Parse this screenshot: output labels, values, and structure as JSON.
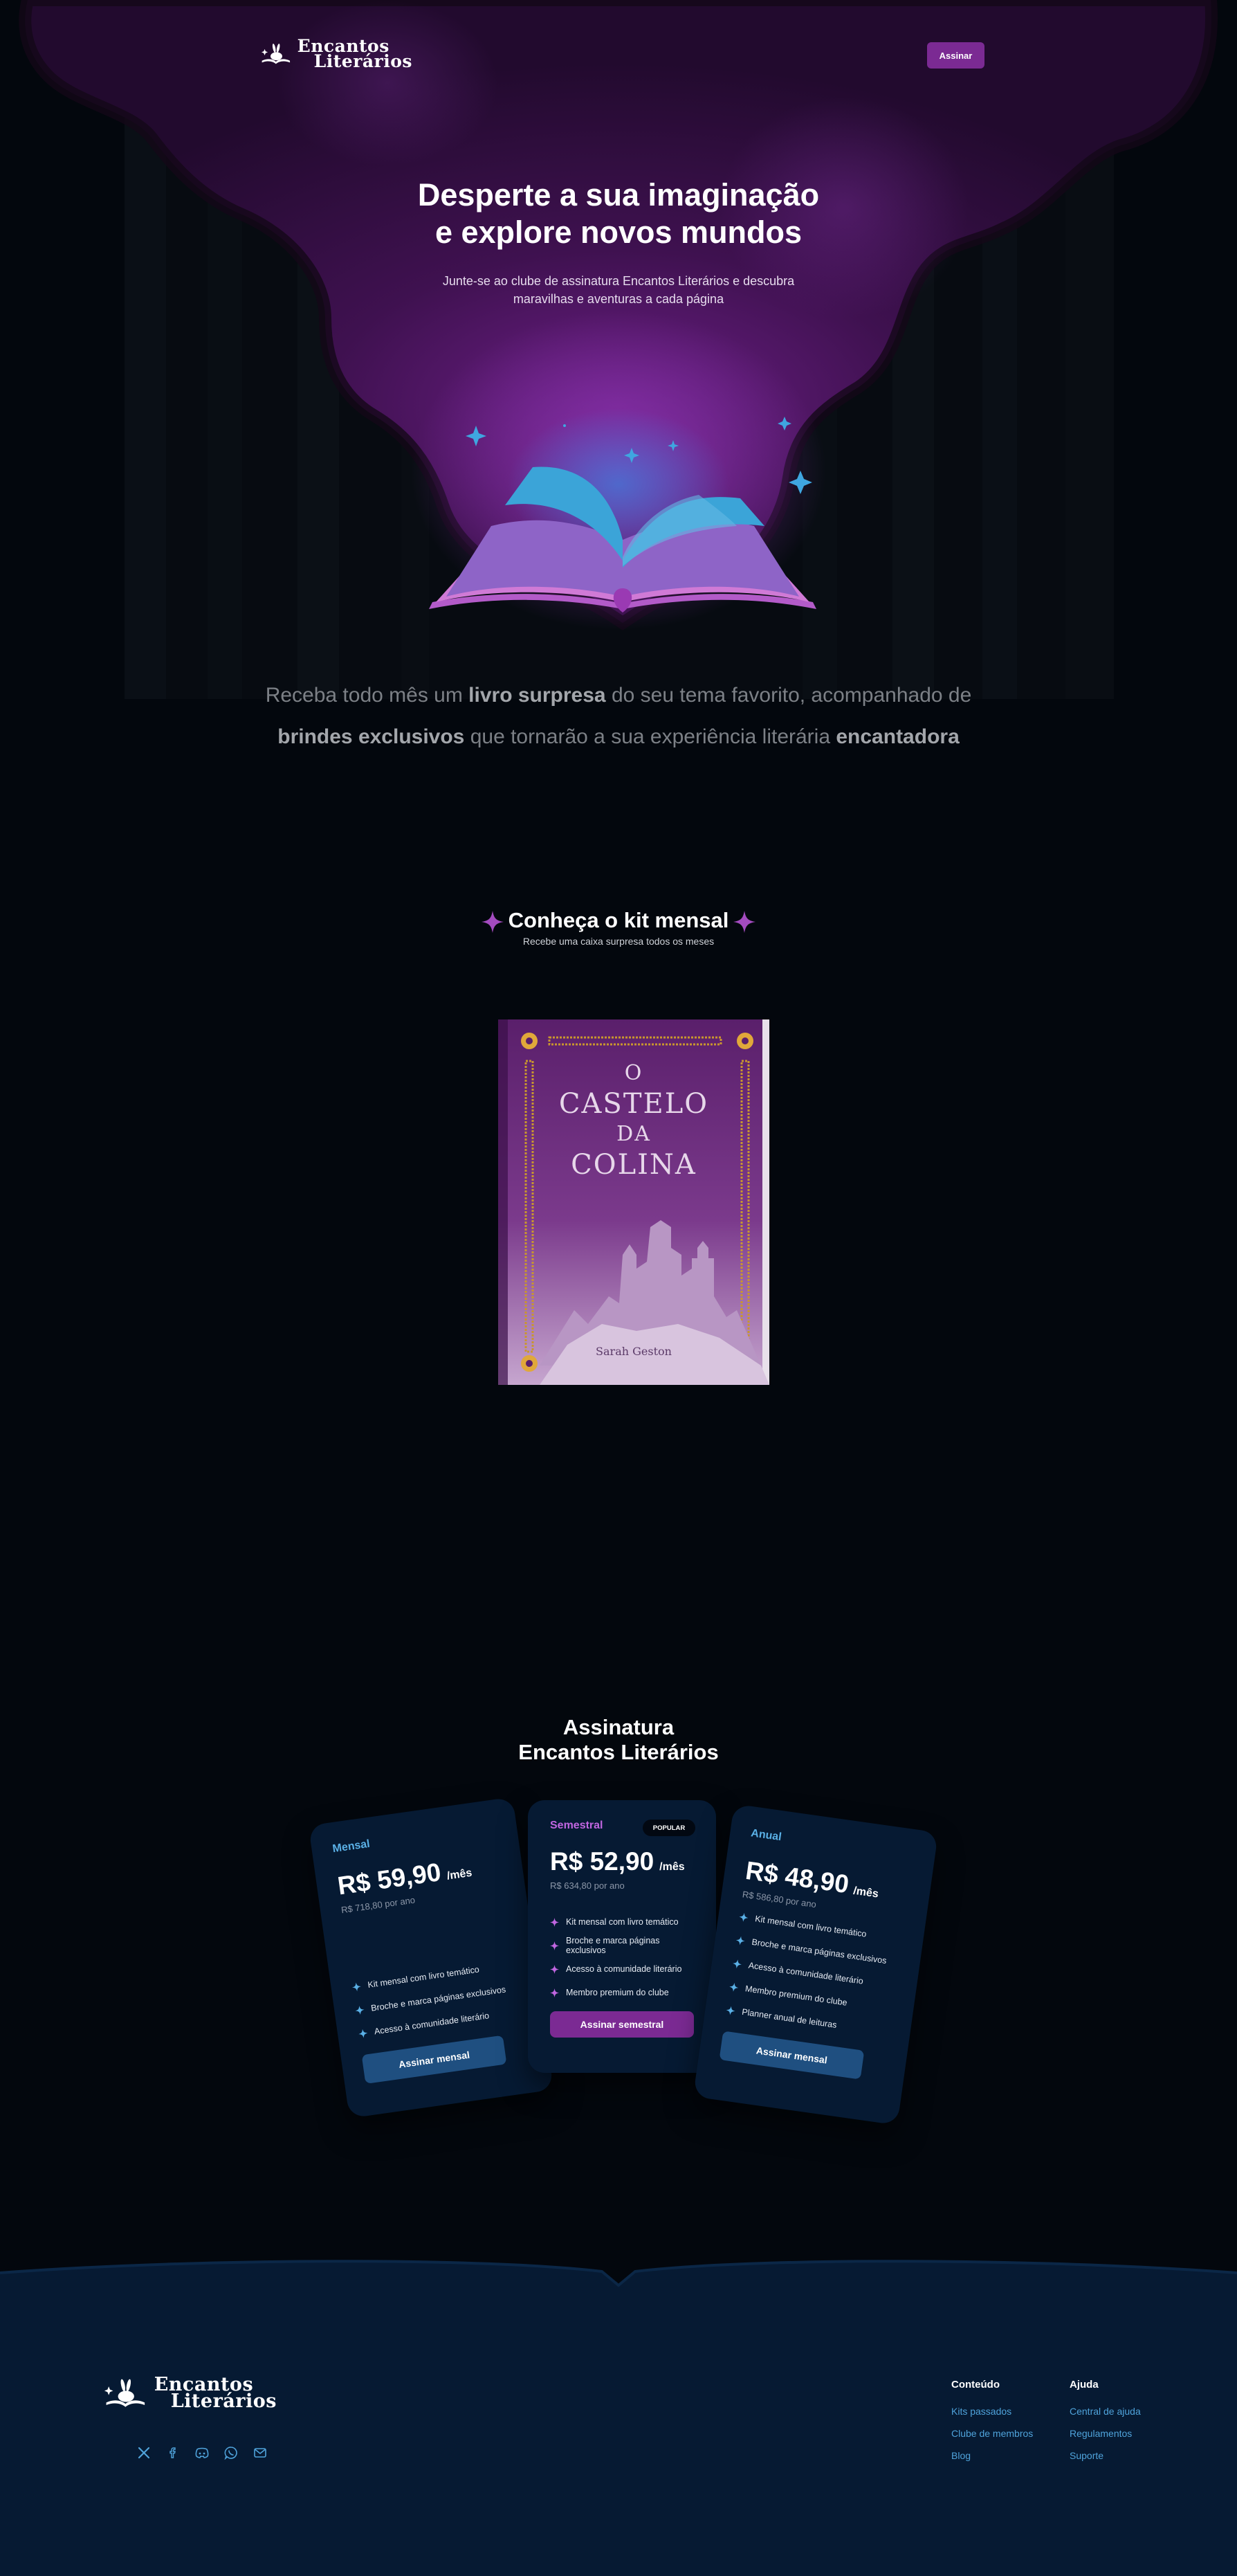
{
  "brand": {
    "name_line1": "Encantos",
    "name_line2": "Literários"
  },
  "nav": {
    "subscribe_label": "Assinar"
  },
  "hero": {
    "title_line1": "Desperte a sua imaginação",
    "title_line2": "e explore novos mundos",
    "subtitle_line1": "Junte-se ao clube de assinatura Encantos Literários e descubra",
    "subtitle_line2": "maravilhas e aventuras a cada página"
  },
  "intro": {
    "part1": "Receba todo mês um ",
    "bold1": "livro surpresa",
    "part2": " do seu tema favorito, acompanhado de",
    "bold2": "brindes exclusivos",
    "part3": " que tornarão a sua experiência literária ",
    "bold3": "encantadora"
  },
  "kit": {
    "title": "Conheça o kit mensal",
    "subtitle": "Recebe uma caixa surpresa todos os meses",
    "book": {
      "title_line1": "O",
      "title_line2": "CASTELO",
      "title_line3": "DA",
      "title_line4": "COLINA",
      "author": "Sarah Geston"
    }
  },
  "pricing": {
    "title_line1": "Assinatura",
    "title_line2": "Encantos Literários",
    "plans": [
      {
        "name": "Mensal",
        "price": "R$ 59,90",
        "per": "/mês",
        "yearly": "R$ 718,80 por ano",
        "features": [
          "Kit mensal com livro temático",
          "Broche e marca páginas exclusivos",
          "Acesso à comunidade literário"
        ],
        "button": "Assinar mensal",
        "accent": "#5ab0e6"
      },
      {
        "name": "Semestral",
        "badge": "POPULAR",
        "price": "R$ 52,90",
        "per": "/mês",
        "yearly": "R$ 634,80 por ano",
        "features": [
          "Kit mensal com livro temático",
          "Broche e marca páginas exclusivos",
          "Acesso à comunidade literário",
          "Membro premium do clube"
        ],
        "button": "Assinar semestral",
        "accent": "#c066e0"
      },
      {
        "name": "Anual",
        "price": "R$ 48,90",
        "per": "/mês",
        "yearly": "R$ 586,80 por ano",
        "features": [
          "Kit mensal com livro temático",
          "Broche e marca páginas exclusivos",
          "Acesso à comunidade literário",
          "Membro premium do clube",
          "Planner anual de leituras"
        ],
        "button": "Assinar mensal",
        "accent": "#5ab0e6"
      }
    ]
  },
  "footer": {
    "social_icons": [
      "x-icon",
      "facebook-icon",
      "discord-icon",
      "whatsapp-icon",
      "mail-icon"
    ],
    "col1": {
      "title": "Conteúdo",
      "links": [
        "Kits passados",
        "Clube de membros",
        "Blog"
      ]
    },
    "col2": {
      "title": "Ajuda",
      "links": [
        "Central de ajuda",
        "Regulamentos",
        "Suporte"
      ]
    }
  },
  "colors": {
    "page_bg": "#03070d",
    "purple": "#7b2a93",
    "blue_accent": "#4fa3db",
    "footer_bg": "#061a33",
    "card_bg": "#061a33"
  }
}
